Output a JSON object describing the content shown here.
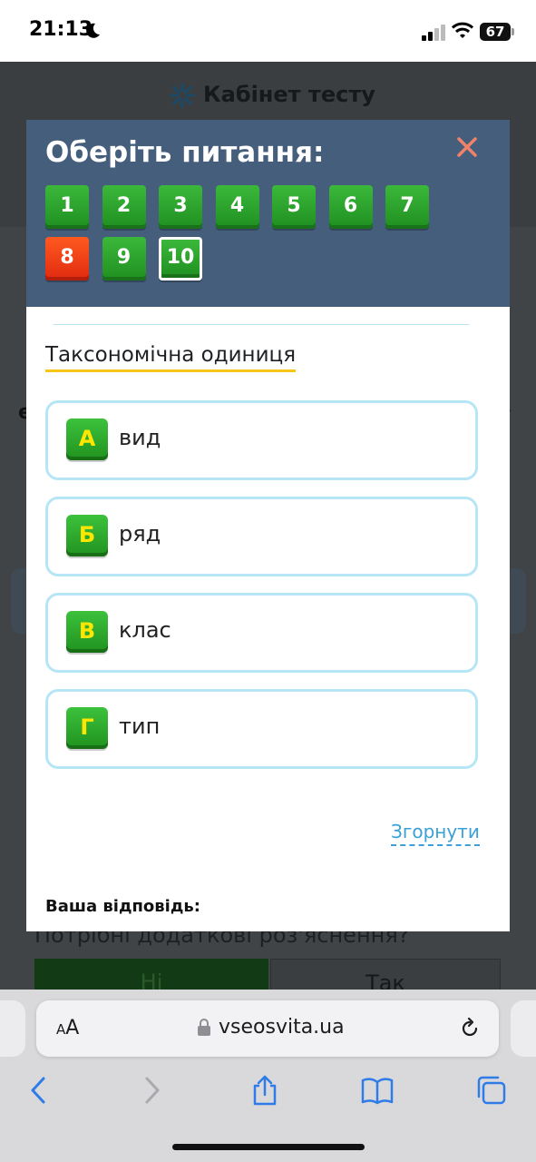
{
  "status_bar": {
    "time": "21:13",
    "battery": "67"
  },
  "background_page": {
    "title": "Кабінет тесту",
    "left_edge_text": "е",
    "right_edge_text": "›",
    "question": "Потрібні додаткові роз'яснення?",
    "button_no": "Ні",
    "button_yes": "Так"
  },
  "modal": {
    "title": "Оберіть питання:",
    "question_numbers": [
      {
        "label": "1",
        "state": "answered"
      },
      {
        "label": "2",
        "state": "answered"
      },
      {
        "label": "3",
        "state": "answered"
      },
      {
        "label": "4",
        "state": "answered"
      },
      {
        "label": "5",
        "state": "answered"
      },
      {
        "label": "6",
        "state": "answered"
      },
      {
        "label": "7",
        "state": "answered"
      },
      {
        "label": "8",
        "state": "wrong"
      },
      {
        "label": "9",
        "state": "answered"
      },
      {
        "label": "10",
        "state": "current"
      }
    ],
    "question_text": "Таксономічна одиниця",
    "options": [
      {
        "letter": "А",
        "text": "вид"
      },
      {
        "letter": "Б",
        "text": "ряд"
      },
      {
        "letter": "В",
        "text": "клас"
      },
      {
        "letter": "Г",
        "text": "тип"
      }
    ],
    "collapse_label": "Згорнути",
    "answer_label": "Ваша відповідь:"
  },
  "browser": {
    "aa_small": "A",
    "aa_large": "A",
    "url": "vseosvita.ua"
  },
  "colors": {
    "header_bg": "#445e7c",
    "green_badge": "#2aa52a",
    "red_badge": "#f04418",
    "option_border": "#b6e6f5",
    "link": "#3aa0d6",
    "underline": "#f5c518"
  },
  "icons": [
    "moon-icon",
    "signal-icon",
    "wifi-icon",
    "battery-icon",
    "logo-icon",
    "close-icon",
    "lock-icon",
    "reload-icon",
    "back-icon",
    "forward-icon",
    "share-icon",
    "bookmarks-icon",
    "tabs-icon"
  ]
}
